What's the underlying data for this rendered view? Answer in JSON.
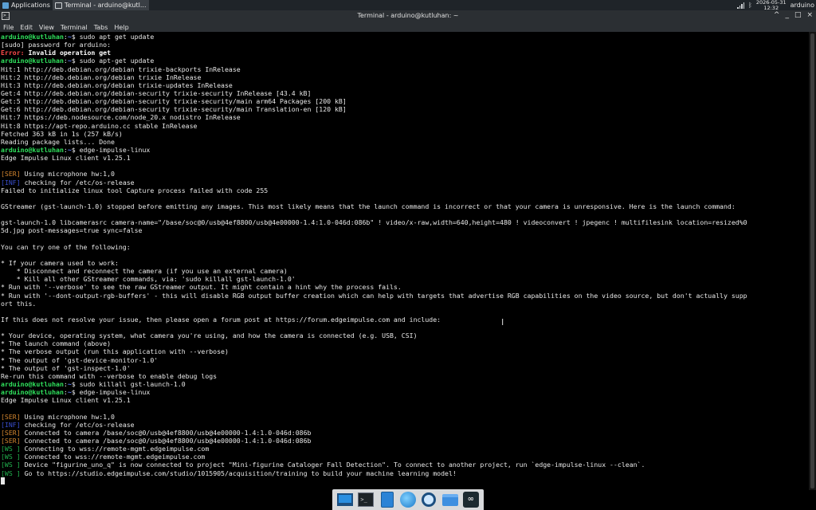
{
  "top_panel": {
    "applications_label": "Applications",
    "task_label": "Terminal - arduino@kutl...",
    "clock_date": "2026-05-31",
    "clock_time": "12:32",
    "user": "arduino"
  },
  "window": {
    "title": "Terminal - arduino@kutluhan: ~",
    "controls": [
      "^",
      "_",
      "□",
      "×"
    ]
  },
  "menu": [
    "File",
    "Edit",
    "View",
    "Terminal",
    "Tabs",
    "Help"
  ],
  "terminal": {
    "lines": [
      [
        {
          "t": "arduino@kutluhan",
          "c": "green"
        },
        {
          "t": ":"
        },
        {
          "t": "~",
          "c": "blue"
        },
        {
          "t": "$ sudo apt get update"
        }
      ],
      [
        {
          "t": "[sudo] password for arduino:"
        }
      ],
      [
        {
          "t": "Error:",
          "c": "red"
        },
        {
          "t": " Invalid operation get",
          "c": "bold"
        }
      ],
      [
        {
          "t": "arduino@kutluhan",
          "c": "green"
        },
        {
          "t": ":"
        },
        {
          "t": "~",
          "c": "blue"
        },
        {
          "t": "$ sudo apt-get update"
        }
      ],
      [
        {
          "t": "Hit:1 http://deb.debian.org/debian trixie-backports InRelease"
        }
      ],
      [
        {
          "t": "Hit:2 http://deb.debian.org/debian trixie InRelease"
        }
      ],
      [
        {
          "t": "Hit:3 http://deb.debian.org/debian trixie-updates InRelease"
        }
      ],
      [
        {
          "t": "Get:4 http://deb.debian.org/debian-security trixie-security InRelease [43.4 kB]"
        }
      ],
      [
        {
          "t": "Get:5 http://deb.debian.org/debian-security trixie-security/main arm64 Packages [200 kB]"
        }
      ],
      [
        {
          "t": "Get:6 http://deb.debian.org/debian-security trixie-security/main Translation-en [120 kB]"
        }
      ],
      [
        {
          "t": "Hit:7 https://deb.nodesource.com/node_20.x nodistro InRelease"
        }
      ],
      [
        {
          "t": "Hit:8 https://apt-repo.arduino.cc stable InRelease"
        }
      ],
      [
        {
          "t": "Fetched 363 kB in 1s (257 kB/s)"
        }
      ],
      [
        {
          "t": "Reading package lists... Done"
        }
      ],
      [
        {
          "t": "arduino@kutluhan",
          "c": "green"
        },
        {
          "t": ":"
        },
        {
          "t": "~",
          "c": "blue"
        },
        {
          "t": "$ edge-impulse-linux"
        }
      ],
      [
        {
          "t": "Edge Impulse Linux client v1.25.1"
        }
      ],
      [
        {
          "t": ""
        }
      ],
      [
        {
          "t": "[SER]",
          "c": "ser"
        },
        {
          "t": " Using microphone hw:1,0"
        }
      ],
      [
        {
          "t": "[INF]",
          "c": "info"
        },
        {
          "t": " checking for /etc/os-release"
        }
      ],
      [
        {
          "t": "Failed to initialize linux tool Capture process failed with code 255"
        }
      ],
      [
        {
          "t": ""
        }
      ],
      [
        {
          "t": "GStreamer (gst-launch-1.0) stopped before emitting any images. This most likely means that the launch command is incorrect or that your camera is unresponsive. Here is the launch command:"
        }
      ],
      [
        {
          "t": ""
        }
      ],
      [
        {
          "t": "gst-launch-1.0 libcamerasrc camera-name=\"/base/soc@0/usb@4ef8800/usb@4e00000-1.4:1.0-046d:086b\" ! video/x-raw,width=640,height=480 ! videoconvert ! jpegenc ! multifilesink location=resized%0"
        }
      ],
      [
        {
          "t": "5d.jpg post-messages=true sync=false"
        }
      ],
      [
        {
          "t": ""
        }
      ],
      [
        {
          "t": "You can try one of the following:"
        }
      ],
      [
        {
          "t": ""
        }
      ],
      [
        {
          "t": "* If your camera used to work:"
        }
      ],
      [
        {
          "t": "    * Disconnect and reconnect the camera (if you use an external camera)"
        }
      ],
      [
        {
          "t": "    * Kill all other GStreamer commands, via: 'sudo killall gst-launch-1.0'"
        }
      ],
      [
        {
          "t": "* Run with '--verbose' to see the raw GStreamer output. It might contain a hint why the process fails."
        }
      ],
      [
        {
          "t": "* Run with '--dont-output-rgb-buffers' - this will disable RGB output buffer creation which can help with targets that advertise RGB capabilities on the video source, but don't actually supp"
        }
      ],
      [
        {
          "t": "ort this."
        }
      ],
      [
        {
          "t": ""
        }
      ],
      [
        {
          "t": "If this does not resolve your issue, then please open a forum post at https://forum.edgeimpulse.com and include:"
        }
      ],
      [
        {
          "t": ""
        }
      ],
      [
        {
          "t": "* Your device, operating system, what camera you're using, and how the camera is connected (e.g. USB, CSI)"
        }
      ],
      [
        {
          "t": "* The launch command (above)"
        }
      ],
      [
        {
          "t": "* The verbose output (run this application with --verbose)"
        }
      ],
      [
        {
          "t": "* The output of 'gst-device-monitor-1.0'"
        }
      ],
      [
        {
          "t": "* The output of 'gst-inspect-1.0'"
        }
      ],
      [
        {
          "t": "Re-run this command with --verbose to enable debug logs"
        }
      ],
      [
        {
          "t": "arduino@kutluhan",
          "c": "green"
        },
        {
          "t": ":"
        },
        {
          "t": "~",
          "c": "blue"
        },
        {
          "t": "$ sudo killall gst-launch-1.0"
        }
      ],
      [
        {
          "t": "arduino@kutluhan",
          "c": "green"
        },
        {
          "t": ":"
        },
        {
          "t": "~",
          "c": "blue"
        },
        {
          "t": "$ edge-impulse-linux"
        }
      ],
      [
        {
          "t": "Edge Impulse Linux client v1.25.1"
        }
      ],
      [
        {
          "t": ""
        }
      ],
      [
        {
          "t": "[SER]",
          "c": "ser"
        },
        {
          "t": " Using microphone hw:1,0"
        }
      ],
      [
        {
          "t": "[INF]",
          "c": "info"
        },
        {
          "t": " checking for /etc/os-release"
        }
      ],
      [
        {
          "t": "[SER]",
          "c": "ser"
        },
        {
          "t": " Connected to camera /base/soc@0/usb@4ef8800/usb@4e00000-1.4:1.0-046d:086b"
        }
      ],
      [
        {
          "t": "[SER]",
          "c": "ser"
        },
        {
          "t": " Connected to camera /base/soc@0/usb@4ef8800/usb@4e00000-1.4:1.0-046d:086b"
        }
      ],
      [
        {
          "t": "[WS ]",
          "c": "ws"
        },
        {
          "t": " Connecting to wss://remote-mgmt.edgeimpulse.com"
        }
      ],
      [
        {
          "t": "[WS ]",
          "c": "ws"
        },
        {
          "t": " Connected to wss://remote-mgmt.edgeimpulse.com"
        }
      ],
      [
        {
          "t": "[WS ]",
          "c": "ws"
        },
        {
          "t": " Device \"figurine_uno_q\" is now connected to project \"Mini-figurine Cataloger Fall Detection\". To connect to another project, run `edge-impulse-linux --clean`."
        }
      ],
      [
        {
          "t": "[WS ]",
          "c": "ws"
        },
        {
          "t": " Go to https://studio.edgeimpulse.com/studio/1015905/acquisition/training to build your machine learning model!"
        }
      ]
    ]
  },
  "dock": {
    "items": [
      "screen-icon",
      "terminal-icon",
      "files-icon",
      "browser-icon",
      "search-icon",
      "folder-icon",
      "arduino-icon"
    ],
    "terminal_glyph": ">_",
    "arduino_glyph": "∞"
  }
}
